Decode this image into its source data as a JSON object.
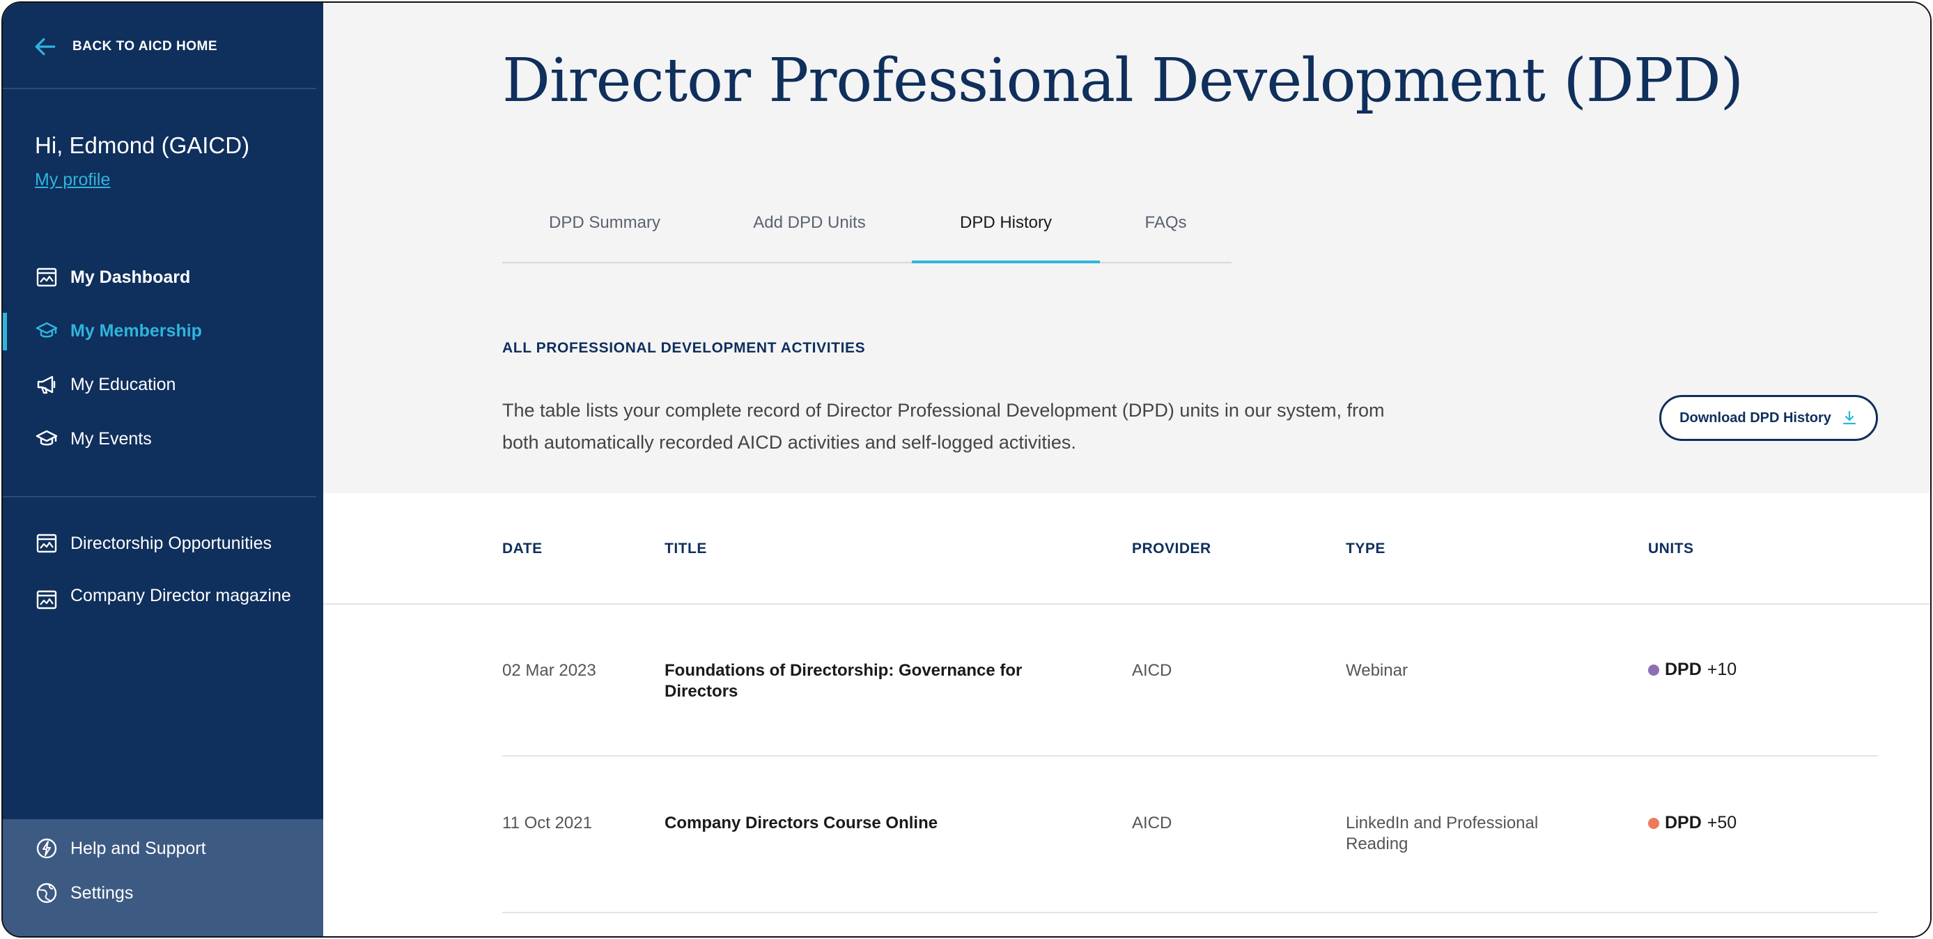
{
  "sidebar": {
    "back_label": "BACK TO AICD HOME",
    "greeting": "Hi, Edmond (GAICD)",
    "profile_link": "My profile",
    "nav_primary": [
      {
        "label": "My Dashboard",
        "icon": "chart-window-icon"
      },
      {
        "label": "My Membership",
        "icon": "graduation-cap-icon",
        "active": true
      },
      {
        "label": "My Education",
        "icon": "megaphone-icon"
      },
      {
        "label": "My Events",
        "icon": "graduation-cap-icon"
      }
    ],
    "nav_secondary": [
      {
        "label": "Directorship Opportunities",
        "icon": "chart-window-icon"
      },
      {
        "label": "Company Director magazine",
        "icon": "chart-window-icon"
      }
    ],
    "nav_bottom": [
      {
        "label": "Help and Support",
        "icon": "lightning-circle-icon"
      },
      {
        "label": "Settings",
        "icon": "globe-icon"
      }
    ]
  },
  "main": {
    "title": "Director Professional Development (DPD)",
    "tabs": [
      {
        "label": "DPD Summary"
      },
      {
        "label": "Add DPD Units"
      },
      {
        "label": "DPD History",
        "active": true
      },
      {
        "label": "FAQs"
      }
    ],
    "section_label": "ALL PROFESSIONAL DEVELOPMENT ACTIVITIES",
    "description": "The table lists your complete record of Director Professional Development (DPD) units in our system, from both automatically recorded AICD activities and self-logged activities.",
    "download_button": "Download DPD History"
  },
  "table": {
    "headers": {
      "date": "DATE",
      "title": "TITLE",
      "provider": "PROVIDER",
      "type": "TYPE",
      "units": "UNITS"
    },
    "rows": [
      {
        "date": "02 Mar 2023",
        "title": "Foundations of Directorship: Governance for Directors",
        "provider": "AICD",
        "type": "Webinar",
        "unit_tag": "DPD",
        "unit_value": "+10",
        "dot_color": "#8e6fb3"
      },
      {
        "date": "11 Oct 2021",
        "title": "Company Directors Course Online",
        "provider": "AICD",
        "type": "LinkedIn and Professional Reading",
        "unit_tag": "DPD",
        "unit_value": "+50",
        "dot_color": "#ee7a5c"
      }
    ]
  },
  "colors": {
    "sidebar_bg": "#0f2f5c",
    "accent": "#2fb5dd",
    "sidebar_bottom_bg": "#3d5a82",
    "hero_bg": "#f4f4f4"
  }
}
